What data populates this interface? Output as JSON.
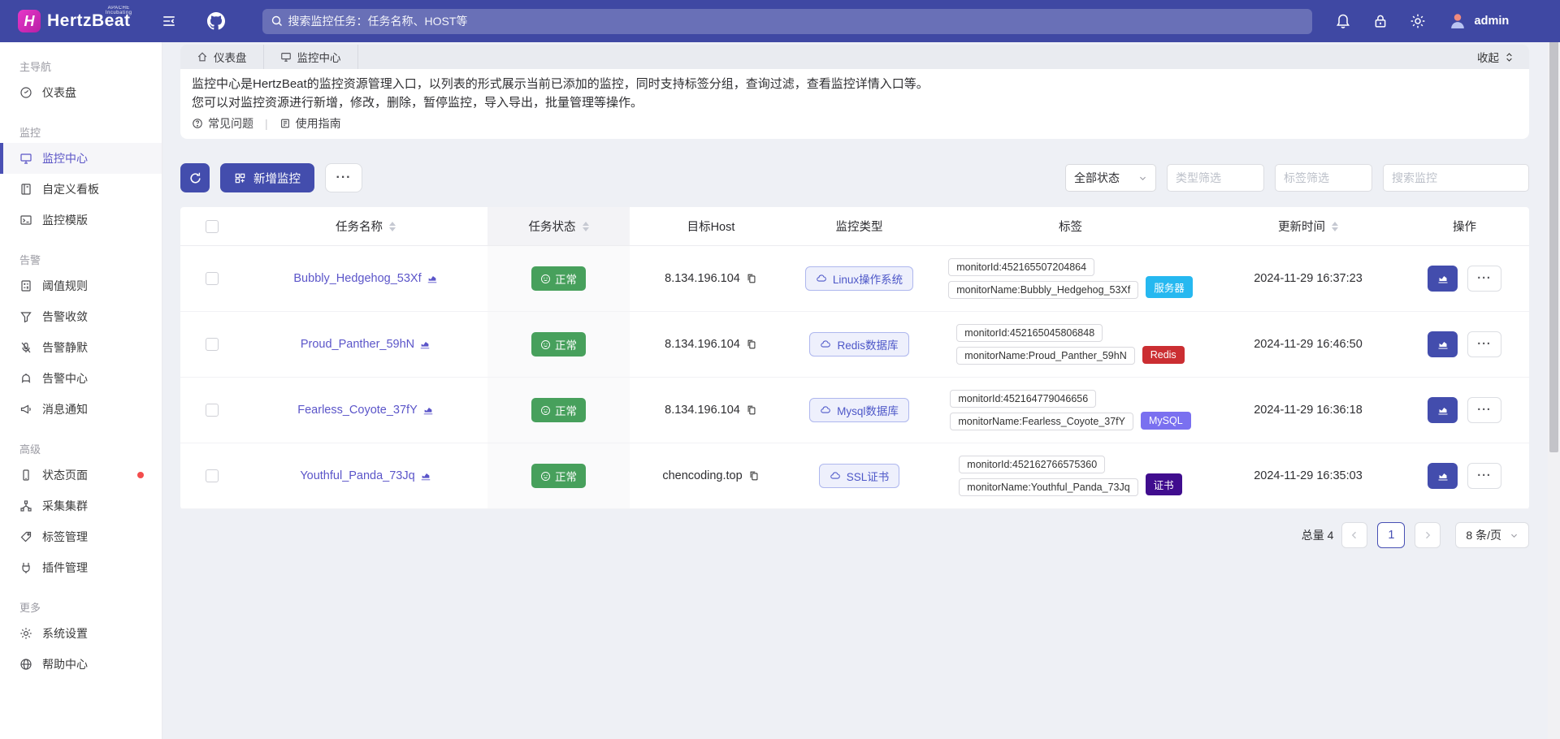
{
  "colors": {
    "topbar": "#3f48a3",
    "primary": "#434dad",
    "link": "#5b55c9",
    "status_ok": "#47a05c",
    "badge_dot": "#f34d4d",
    "tag_server": "#26b8f0",
    "tag_redis": "#cb2e32",
    "tag_mysql": "#7a70f0",
    "tag_cert": "#400d8e"
  },
  "topbar": {
    "brand_mark": "H",
    "brand": "HertzBeat",
    "badge_top": "APACHE",
    "badge_bottom": "Incubating",
    "search_placeholder": "搜索监控任务：任务名称、HOST等",
    "user": "admin",
    "icons": [
      "menu-fold-icon",
      "github-icon",
      "search-icon",
      "bell-icon",
      "lock-icon",
      "gear-icon",
      "avatar-icon"
    ]
  },
  "sidebar": {
    "items": [
      {
        "type": "section",
        "label": "主导航"
      },
      {
        "type": "item",
        "label": "仪表盘",
        "icon": "gauge-icon"
      },
      {
        "type": "section",
        "label": "监控"
      },
      {
        "type": "item",
        "label": "监控中心",
        "icon": "monitor-icon",
        "active": true
      },
      {
        "type": "item",
        "label": "自定义看板",
        "icon": "board-icon"
      },
      {
        "type": "item",
        "label": "监控模版",
        "icon": "template-icon"
      },
      {
        "type": "section",
        "label": "告警"
      },
      {
        "type": "item",
        "label": "阈值规则",
        "icon": "threshold-icon"
      },
      {
        "type": "item",
        "label": "告警收敛",
        "icon": "funnel-icon"
      },
      {
        "type": "item",
        "label": "告警静默",
        "icon": "mute-icon"
      },
      {
        "type": "item",
        "label": "告警中心",
        "icon": "alarm-icon"
      },
      {
        "type": "item",
        "label": "消息通知",
        "icon": "megaphone-icon"
      },
      {
        "type": "section",
        "label": "高级"
      },
      {
        "type": "item",
        "label": "状态页面",
        "icon": "status-page-icon",
        "badge": true
      },
      {
        "type": "item",
        "label": "采集集群",
        "icon": "cluster-icon"
      },
      {
        "type": "item",
        "label": "标签管理",
        "icon": "tag-icon"
      },
      {
        "type": "item",
        "label": "插件管理",
        "icon": "plugin-icon"
      },
      {
        "type": "section",
        "label": "更多"
      },
      {
        "type": "item",
        "label": "系统设置",
        "icon": "settings-icon"
      },
      {
        "type": "item",
        "label": "帮助中心",
        "icon": "help-icon"
      }
    ]
  },
  "tabsbar": {
    "tabs": [
      {
        "label": "仪表盘",
        "icon": "home-icon"
      },
      {
        "label": "监控中心",
        "icon": "monitor-icon"
      }
    ],
    "collapse": "收起"
  },
  "intro": {
    "line1": "监控中心是HertzBeat的监控资源管理入口，以列表的形式展示当前已添加的监控，同时支持标签分组，查询过滤，查看监控详情入口等。",
    "line2": "您可以对监控资源进行新增，修改，删除，暂停监控，导入导出，批量管理等操作。",
    "faq": "常见问题",
    "divider": "|",
    "guide": "使用指南"
  },
  "toolbar": {
    "add": "新增监控",
    "more": "···",
    "status_filter": "全部状态",
    "type_placeholder": "类型筛选",
    "tag_placeholder": "标签筛选",
    "search_placeholder": "搜索监控"
  },
  "table": {
    "headers": {
      "name": "任务名称",
      "status": "任务状态",
      "host": "目标Host",
      "type": "监控类型",
      "tags": "标签",
      "time": "更新时间",
      "actions": "操作"
    },
    "rows": [
      {
        "name": "Bubbly_Hedgehog_53Xf",
        "status": "正常",
        "host": "8.134.196.104",
        "type": "Linux操作系统",
        "tag_id": "monitorId:452165507204864",
        "tag_name": "monitorName:Bubbly_Hedgehog_53Xf",
        "tag": "服务器",
        "tag_color": "#26b8f0",
        "time": "2024-11-29 16:37:23"
      },
      {
        "name": "Proud_Panther_59hN",
        "status": "正常",
        "host": "8.134.196.104",
        "type": "Redis数据库",
        "tag_id": "monitorId:452165045806848",
        "tag_name": "monitorName:Proud_Panther_59hN",
        "tag": "Redis",
        "tag_color": "#cb2e32",
        "time": "2024-11-29 16:46:50"
      },
      {
        "name": "Fearless_Coyote_37fY",
        "status": "正常",
        "host": "8.134.196.104",
        "type": "Mysql数据库",
        "tag_id": "monitorId:452164779046656",
        "tag_name": "monitorName:Fearless_Coyote_37fY",
        "tag": "MySQL",
        "tag_color": "#7a70f0",
        "time": "2024-11-29 16:36:18"
      },
      {
        "name": "Youthful_Panda_73Jq",
        "status": "正常",
        "host": "chencoding.top",
        "type": "SSL证书",
        "tag_id": "monitorId:452162766575360",
        "tag_name": "monitorName:Youthful_Panda_73Jq",
        "tag": "证书",
        "tag_color": "#400d8e",
        "time": "2024-11-29 16:35:03"
      }
    ]
  },
  "pagination": {
    "total": "总量 4",
    "page": "1",
    "size": "8 条/页"
  }
}
